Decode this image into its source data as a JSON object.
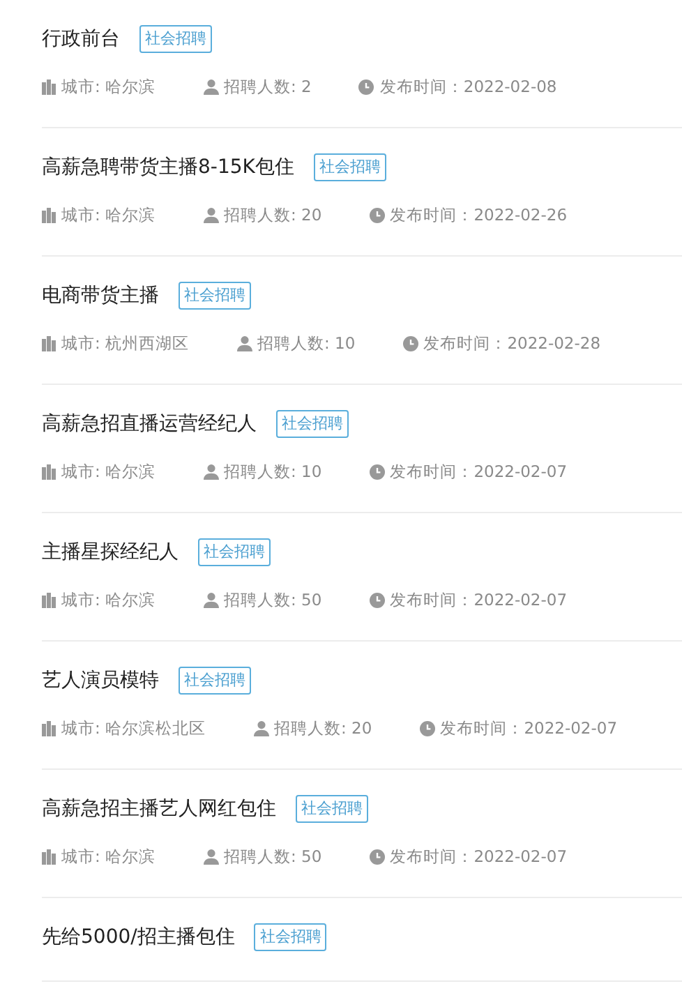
{
  "jobs": [
    {
      "title": "行政前台",
      "tag": "社会招聘",
      "city": "城市: 哈尔滨",
      "headcount": "招聘人数: 2",
      "posted": "发布时间：2022-02-08"
    },
    {
      "title": "高薪急聘带货主播8-15K包住",
      "tag": "社会招聘",
      "city": "城市: 哈尔滨",
      "headcount": "招聘人数: 20",
      "posted": "发布时间：2022-02-26"
    },
    {
      "title": "电商带货主播",
      "tag": "社会招聘",
      "city": "城市: 杭州西湖区",
      "headcount": "招聘人数: 10",
      "posted": "发布时间：2022-02-28"
    },
    {
      "title": "高薪急招直播运营经纪人",
      "tag": "社会招聘",
      "city": "城市: 哈尔滨",
      "headcount": "招聘人数: 10",
      "posted": "发布时间：2022-02-07"
    },
    {
      "title": "主播星探经纪人",
      "tag": "社会招聘",
      "city": "城市: 哈尔滨",
      "headcount": "招聘人数: 50",
      "posted": "发布时间：2022-02-07"
    },
    {
      "title": "艺人演员模特",
      "tag": "社会招聘",
      "city": "城市: 哈尔滨松北区",
      "headcount": "招聘人数: 20",
      "posted": "发布时间：2022-02-07"
    },
    {
      "title": "高薪急招主播艺人网红包住",
      "tag": "社会招聘",
      "city": "城市: 哈尔滨",
      "headcount": "招聘人数: 50",
      "posted": "发布时间：2022-02-07"
    },
    {
      "title": "先给5000/招主播包住",
      "tag": "社会招聘"
    }
  ]
}
